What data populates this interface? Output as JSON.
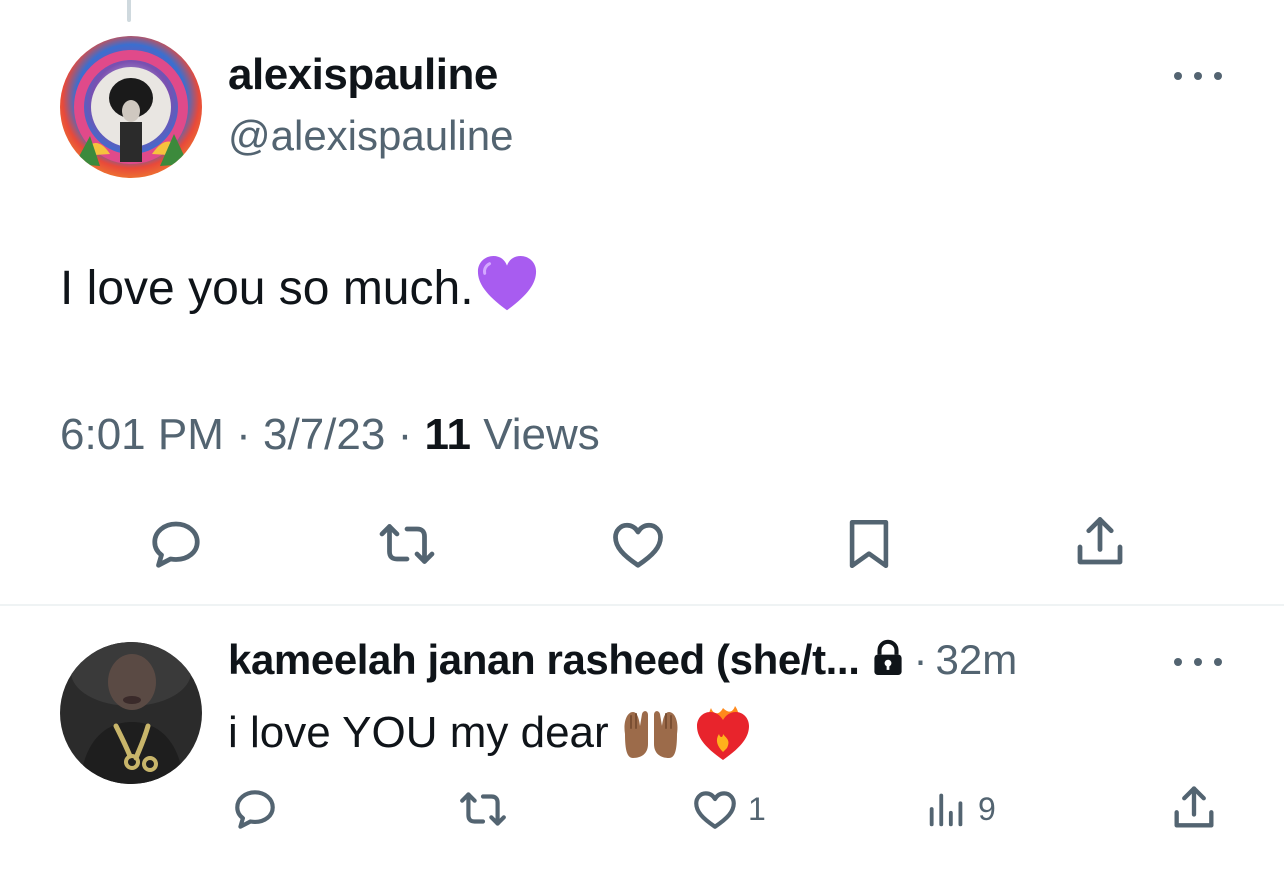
{
  "main_tweet": {
    "display_name": "alexispauline",
    "handle": "@alexispauline",
    "text": "I love you so much.",
    "emoji": "purple-heart",
    "time": "6:01 PM",
    "separator": "·",
    "date": "3/7/23",
    "views_count": "11",
    "views_label": "Views"
  },
  "reply": {
    "display_name": "kameelah janan rasheed (she/t...",
    "time_ago": "32m",
    "separator": "·",
    "text": "i love YOU my dear",
    "emojis": [
      "palms-up-together-medium-dark",
      "heart-on-fire"
    ],
    "likes": "1",
    "views": "9"
  },
  "icons": {
    "actions_main": [
      "reply-icon",
      "retweet-icon",
      "like-icon",
      "bookmark-icon",
      "share-icon"
    ],
    "actions_reply": [
      "reply-icon",
      "retweet-icon",
      "like-icon",
      "views-icon",
      "share-icon"
    ]
  },
  "colors": {
    "text": "#0f1419",
    "secondary": "#536471",
    "divider": "#eff3f4",
    "purple_heart": "#a85cf0"
  }
}
